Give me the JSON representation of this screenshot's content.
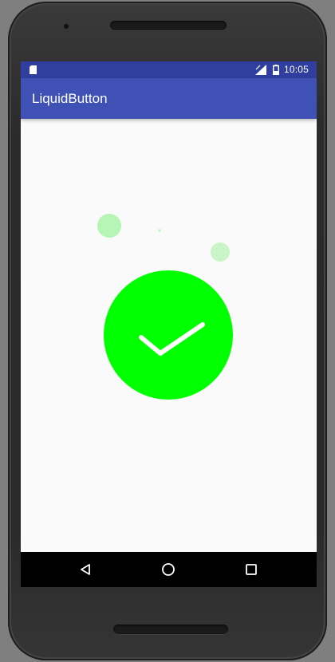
{
  "status_bar": {
    "time": "10:05",
    "icons": [
      "sd-card-icon",
      "signal-icon",
      "battery-icon"
    ]
  },
  "app_bar": {
    "title": "LiquidButton"
  },
  "liquid_button": {
    "state": "complete",
    "icon": "check-icon"
  },
  "nav_bar": {
    "icons": [
      "back-icon",
      "home-icon",
      "recents-icon"
    ]
  },
  "colors": {
    "status_bar": "#303f9f",
    "app_bar": "#3f51b5",
    "button_fill": "#00ff00",
    "bubble_light": "#b6f5b6",
    "background": "#fafafa",
    "nav_bar": "#000000"
  }
}
